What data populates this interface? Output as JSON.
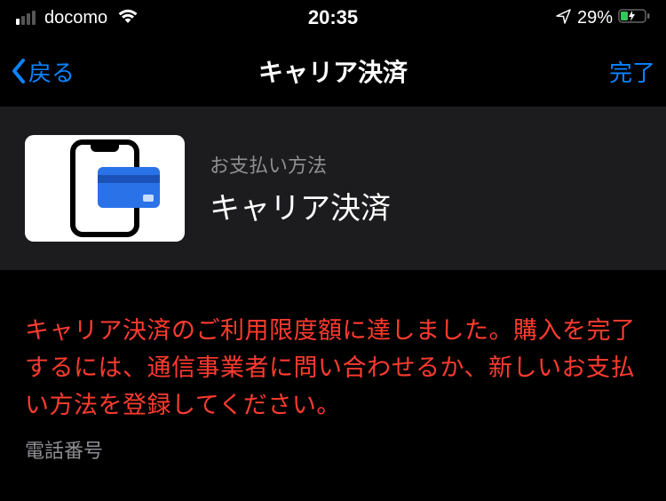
{
  "statusBar": {
    "carrier": "docomo",
    "time": "20:35",
    "batteryPct": "29%"
  },
  "nav": {
    "back": "戻る",
    "title": "キャリア決済",
    "done": "完了"
  },
  "card": {
    "subtitle": "お支払い方法",
    "title": "キャリア決済"
  },
  "error": {
    "message": "キャリア決済のご利用限度額に達しました。購入を完了するには、通信事業者に問い合わせるか、新しいお支払い方法を登録してください。"
  },
  "field": {
    "phoneLabel": "電話番号"
  }
}
